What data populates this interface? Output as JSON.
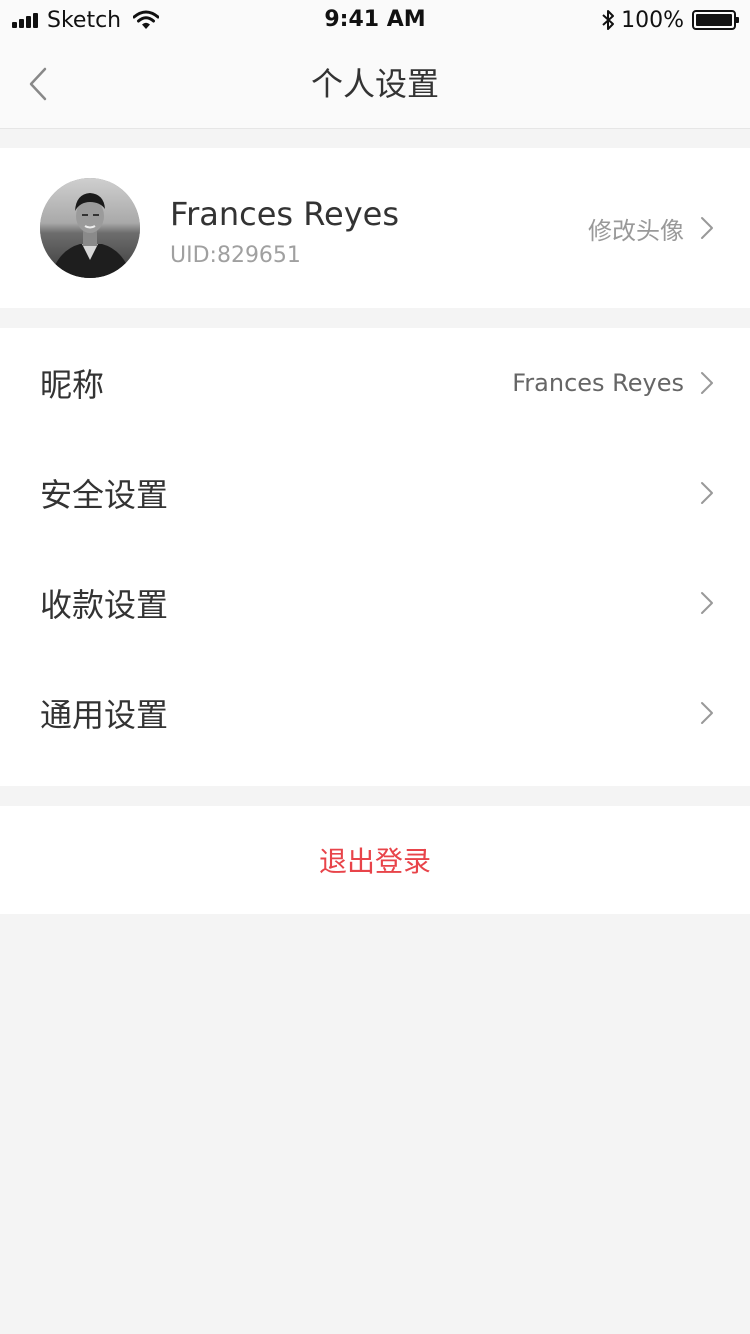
{
  "status_bar": {
    "carrier": "Sketch",
    "time": "9:41 AM",
    "battery": "100%",
    "icons": [
      "signal-icon",
      "wifi-icon",
      "bluetooth-icon",
      "battery-icon"
    ]
  },
  "nav": {
    "title": "个人设置",
    "back_icon": "chevron-left-icon"
  },
  "profile": {
    "name": "Frances Reyes",
    "uid": "UID:829651",
    "edit_avatar_label": "修改头像"
  },
  "settings": {
    "items": [
      {
        "label": "昵称",
        "value": "Frances Reyes"
      },
      {
        "label": "安全设置"
      },
      {
        "label": "收款设置"
      },
      {
        "label": "通用设置"
      }
    ]
  },
  "logout": {
    "label": "退出登录"
  },
  "colors": {
    "background": "#f4f4f4",
    "card": "#ffffff",
    "text_primary": "#333333",
    "text_secondary": "#999999",
    "danger": "#e8444a"
  }
}
